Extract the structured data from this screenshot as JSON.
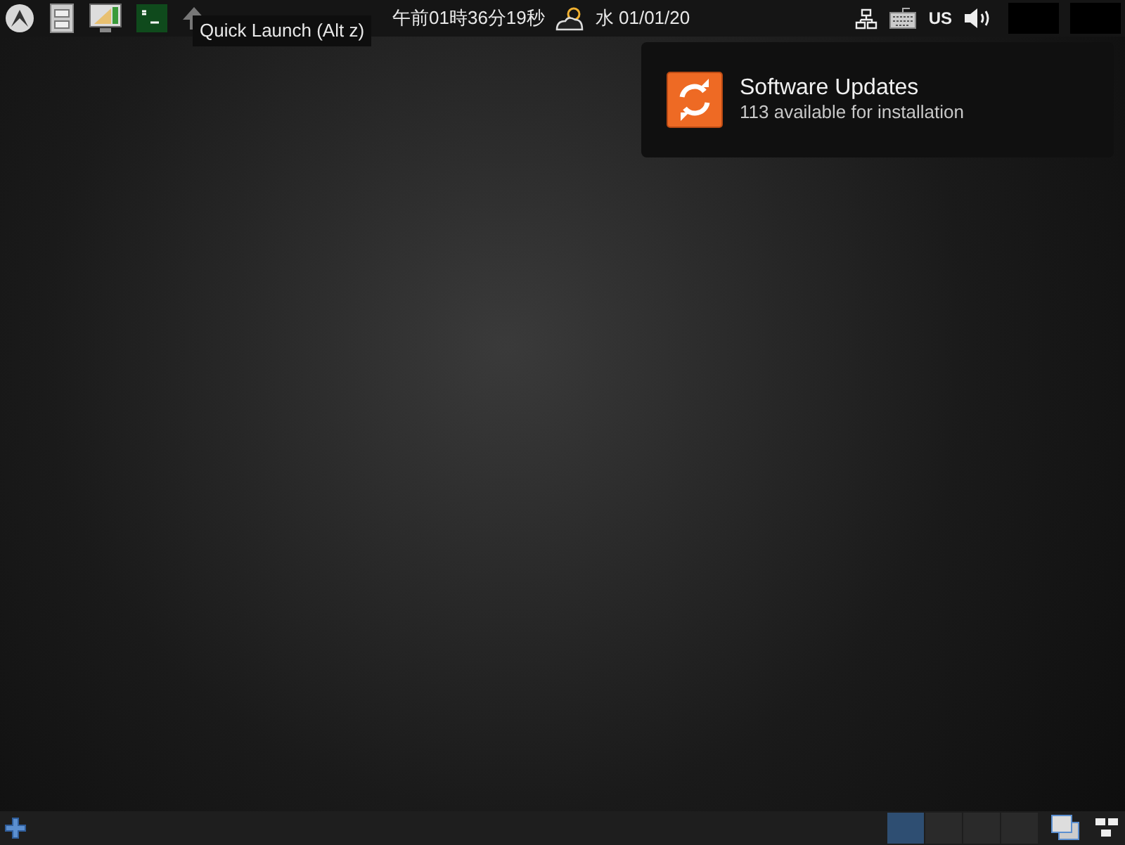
{
  "top_panel": {
    "launchers": [
      {
        "kind": "menu"
      },
      {
        "kind": "files"
      },
      {
        "kind": "monitor"
      },
      {
        "kind": "terminal"
      },
      {
        "kind": "arrow"
      }
    ],
    "tooltip": "Quick Launch (Alt z)",
    "clock": "午前01時36分19秒",
    "date": "水 01/01/20",
    "keyboard_layout": "US"
  },
  "notification": {
    "title": "Software Updates",
    "body": "113 available for installation"
  },
  "bottom_panel": {
    "workspaces": [
      {
        "selected": true
      },
      {
        "selected": false
      },
      {
        "selected": false
      },
      {
        "selected": false
      }
    ]
  }
}
